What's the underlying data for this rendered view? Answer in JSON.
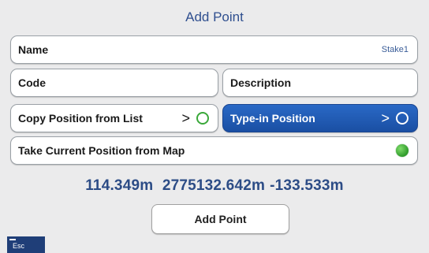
{
  "title": "Add Point",
  "fields": {
    "name": {
      "label": "Name",
      "value": "Stake1"
    },
    "code": {
      "label": "Code"
    },
    "description": {
      "label": "Description"
    }
  },
  "options": {
    "copy_from_list": {
      "label": "Copy Position from List",
      "arrow": ">"
    },
    "type_in": {
      "label": "Type-in Position",
      "arrow": ">"
    },
    "from_map": {
      "label": "Take Current Position from Map"
    }
  },
  "coordinates": {
    "first": "114.349m",
    "second": "2775132.642m",
    "third": "-133.533m"
  },
  "add_button_label": "Add Point",
  "esc_label": "Esc",
  "colors": {
    "selected_option": "#1f5bb8",
    "status_ok": "#33a333",
    "title_text": "#2f4f8f"
  }
}
